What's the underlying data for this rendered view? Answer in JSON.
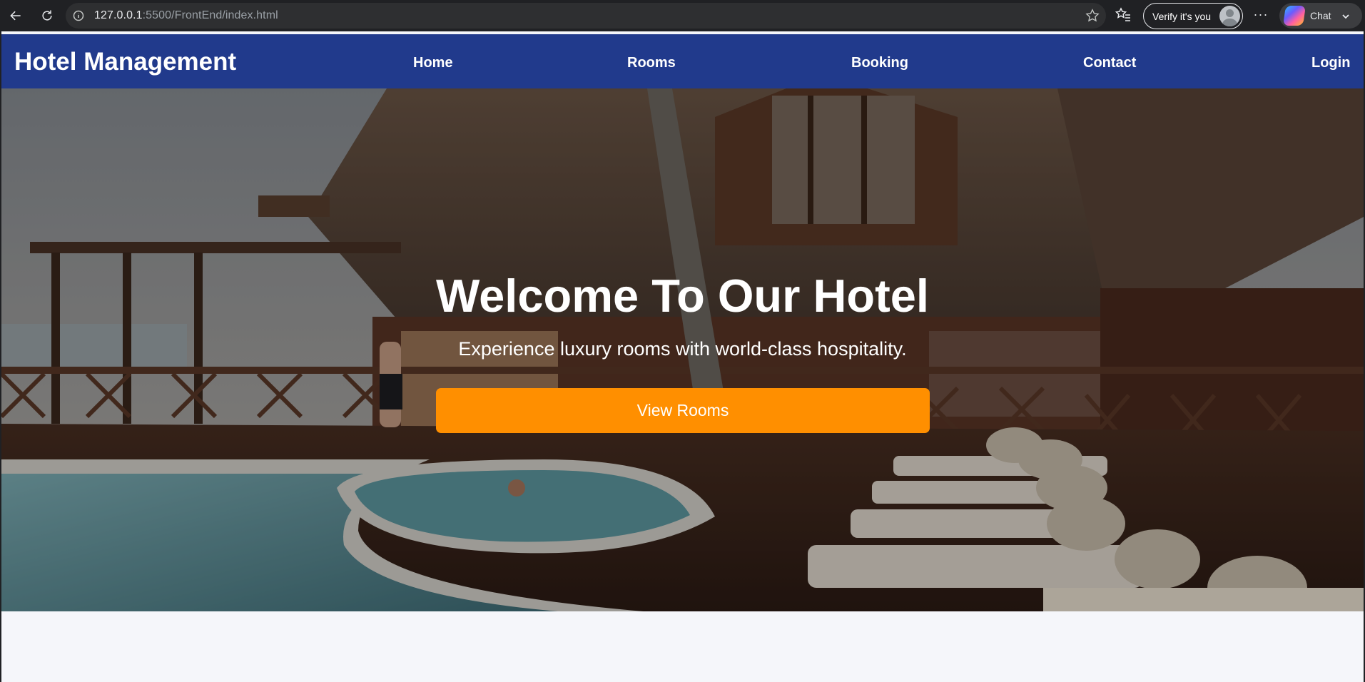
{
  "browser": {
    "url_host": "127.0.0.1",
    "url_path": ":5500/FrontEnd/index.html",
    "verify_label": "Verify it's you",
    "more_label": "···",
    "chat_label": "Chat",
    "icons": [
      "back-arrow-icon",
      "reload-icon",
      "info-icon",
      "star-icon",
      "favorites-icon",
      "avatar-icon",
      "copilot-icon",
      "chevron-down-icon"
    ]
  },
  "navbar": {
    "brand": "Hotel Management",
    "links": [
      {
        "label": "Home"
      },
      {
        "label": "Rooms"
      },
      {
        "label": "Booking"
      },
      {
        "label": "Contact"
      },
      {
        "label": "Login"
      }
    ],
    "background": "#213a8c"
  },
  "hero": {
    "title": "Welcome To Our Hotel",
    "subtitle": "Experience luxury rooms with world-class hospitality.",
    "cta_label": "View Rooms",
    "cta_color": "#ff8f00"
  }
}
